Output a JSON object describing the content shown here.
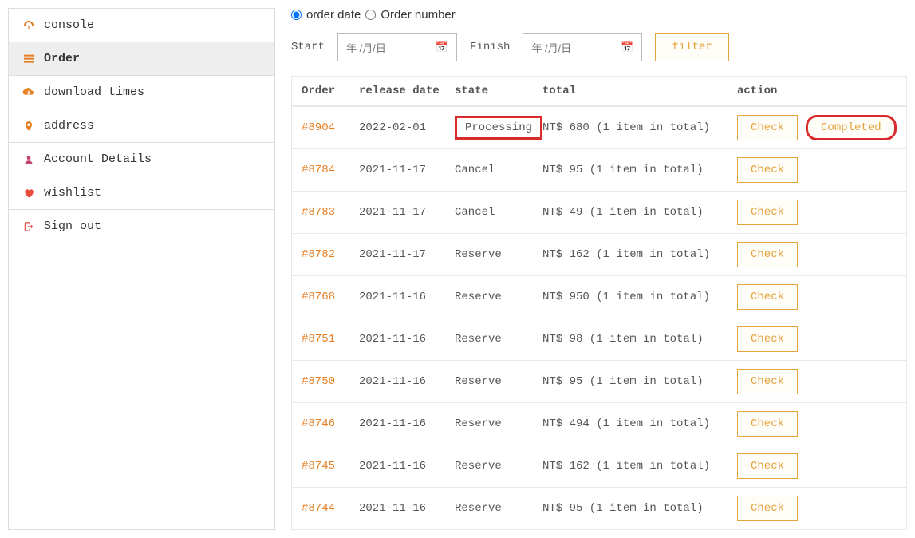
{
  "sidebar": {
    "items": [
      {
        "label": "console"
      },
      {
        "label": "Order"
      },
      {
        "label": "download times"
      },
      {
        "label": "address"
      },
      {
        "label": "Account Details"
      },
      {
        "label": "wishlist"
      },
      {
        "label": "Sign out"
      }
    ]
  },
  "filters": {
    "radio_order_date": "order date",
    "radio_order_number": "Order number",
    "start_label": "Start",
    "finish_label": "Finish",
    "date_placeholder": "年 /月/日",
    "filter_button": "filter"
  },
  "table": {
    "headers": {
      "order": "Order",
      "release_date": "release date",
      "state": "state",
      "total": "total",
      "action": "action"
    },
    "action_check": "Check",
    "action_completed": "Completed",
    "rows": [
      {
        "order": "#8904",
        "date": "2022-02-01",
        "state": "Processing",
        "total": "NT$ 680 (1 item in total)",
        "highlight": true,
        "completed": true
      },
      {
        "order": "#8784",
        "date": "2021-11-17",
        "state": "Cancel",
        "total": "NT$ 95 (1 item in total)"
      },
      {
        "order": "#8783",
        "date": "2021-11-17",
        "state": "Cancel",
        "total": "NT$ 49 (1 item in total)"
      },
      {
        "order": "#8782",
        "date": "2021-11-17",
        "state": "Reserve",
        "total": "NT$ 162 (1 item in total)"
      },
      {
        "order": "#8768",
        "date": "2021-11-16",
        "state": "Reserve",
        "total": "NT$ 950 (1 item in total)"
      },
      {
        "order": "#8751",
        "date": "2021-11-16",
        "state": "Reserve",
        "total": "NT$ 98 (1 item in total)"
      },
      {
        "order": "#8750",
        "date": "2021-11-16",
        "state": "Reserve",
        "total": "NT$ 95 (1 item in total)"
      },
      {
        "order": "#8746",
        "date": "2021-11-16",
        "state": "Reserve",
        "total": "NT$ 494 (1 item in total)"
      },
      {
        "order": "#8745",
        "date": "2021-11-16",
        "state": "Reserve",
        "total": "NT$ 162 (1 item in total)"
      },
      {
        "order": "#8744",
        "date": "2021-11-16",
        "state": "Reserve",
        "total": "NT$ 95 (1 item in total)"
      }
    ]
  }
}
